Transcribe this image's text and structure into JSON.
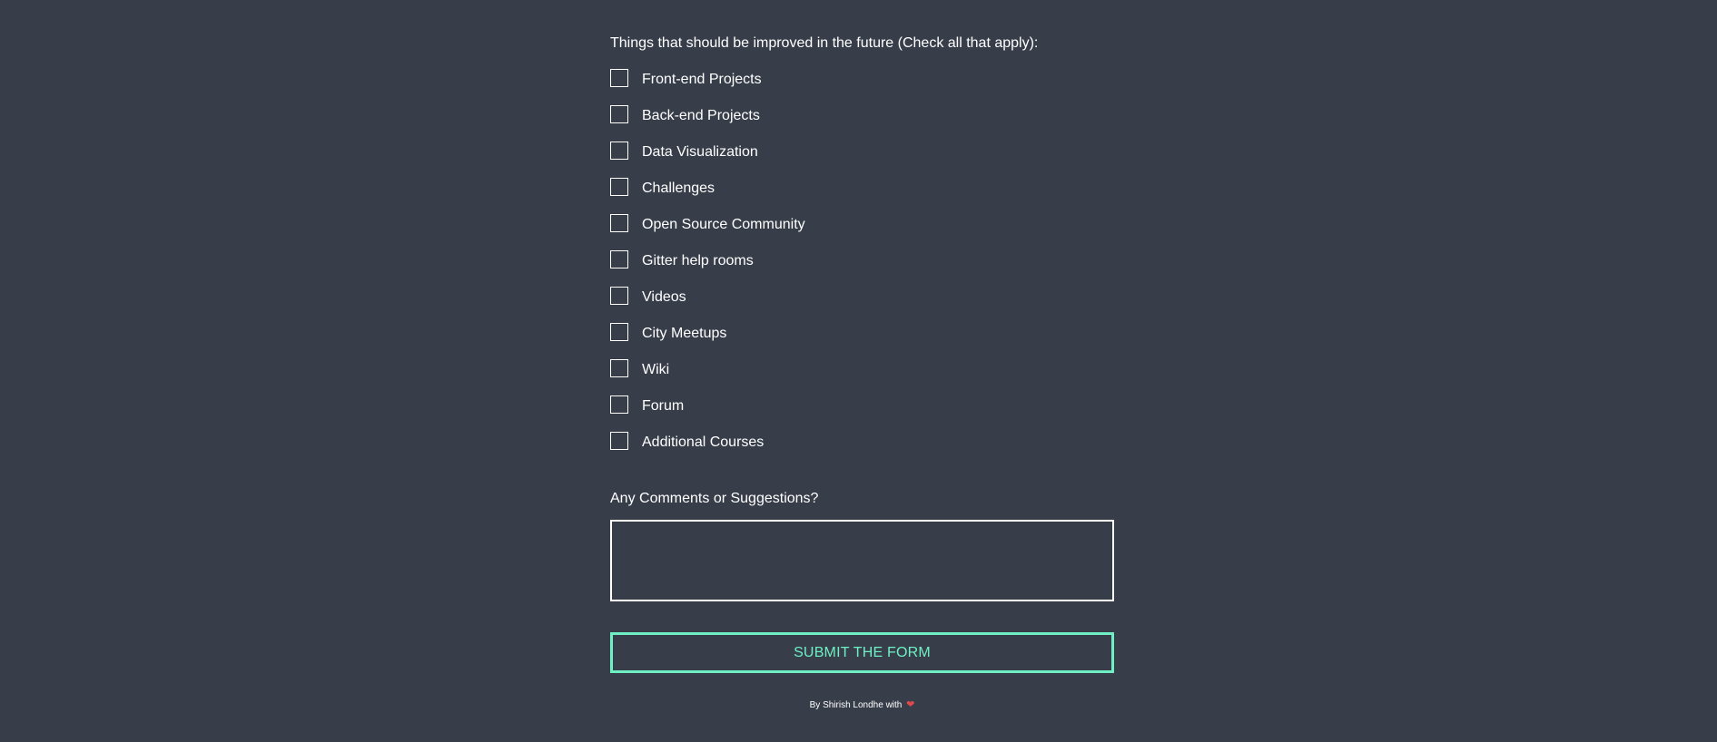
{
  "form": {
    "improve_label": "Things that should be improved in the future (Check all that apply):",
    "improve_options": [
      "Front-end Projects",
      "Back-end Projects",
      "Data Visualization",
      "Challenges",
      "Open Source Community",
      "Gitter help rooms",
      "Videos",
      "City Meetups",
      "Wiki",
      "Forum",
      "Additional Courses"
    ],
    "comments_label": "Any Comments or Suggestions?",
    "comments_value": "",
    "comments_placeholder": "",
    "submit_label": "SUBMIT THE FORM"
  },
  "footer": {
    "text": "By Shirish Londhe with",
    "icon": "heart-icon",
    "icon_color": "#e24a4a"
  },
  "colors": {
    "background": "#373e4a",
    "accent": "#6ef0c4",
    "text": "#ffffff"
  }
}
